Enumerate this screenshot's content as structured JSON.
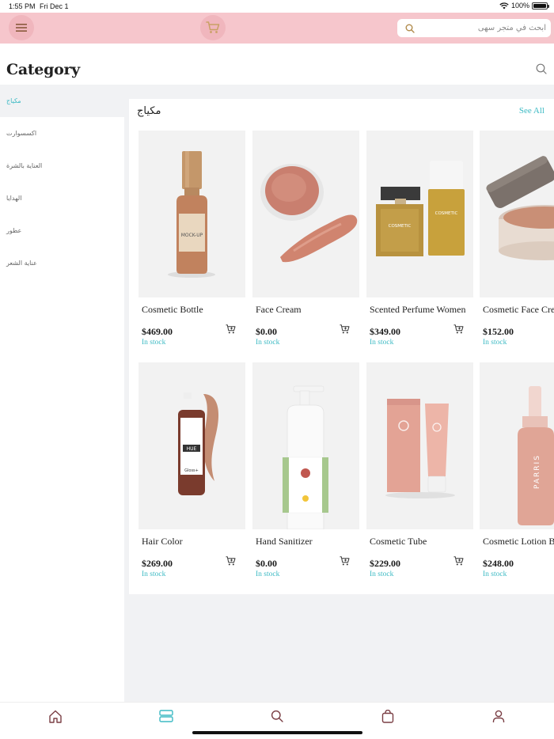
{
  "status_bar": {
    "time": "1:55 PM",
    "date": "Fri Dec 1",
    "battery": "100%"
  },
  "header": {
    "search_placeholder": "ابحث في متجر سهى"
  },
  "page": {
    "title": "Category"
  },
  "sidebar": {
    "items": [
      {
        "label": "مكياج",
        "active": true
      },
      {
        "label": "اكسسوارت",
        "active": false
      },
      {
        "label": "العناية بالشرة",
        "active": false
      },
      {
        "label": "الهدايا",
        "active": false
      },
      {
        "label": "عطور",
        "active": false
      },
      {
        "label": "عناية الشعر",
        "active": false
      }
    ]
  },
  "section": {
    "title": "مكياج",
    "see_all": "See All"
  },
  "products": [
    {
      "name": "Cosmetic Bottle",
      "price": "$469.00",
      "stock": "In stock",
      "icon": "cosmetic-bottle-image"
    },
    {
      "name": "Face Cream",
      "price": "$0.00",
      "stock": "In stock",
      "icon": "face-cream-image"
    },
    {
      "name": "Scented Perfume Women",
      "price": "$349.00",
      "stock": "In stock",
      "icon": "perfume-image"
    },
    {
      "name": "Cosmetic Face Cream",
      "price": "$152.00",
      "stock": "In stock",
      "icon": "face-cream-jar-image"
    },
    {
      "name": "Hair Color",
      "price": "$269.00",
      "stock": "In stock",
      "icon": "hair-color-image"
    },
    {
      "name": "Hand Sanitizer",
      "price": "$0.00",
      "stock": "In stock",
      "icon": "hand-sanitizer-image"
    },
    {
      "name": "Cosmetic Tube",
      "price": "$229.00",
      "stock": "In stock",
      "icon": "cosmetic-tube-image"
    },
    {
      "name": "Cosmetic Lotion Bottle",
      "price": "$248.00",
      "stock": "In stock",
      "icon": "lotion-bottle-image"
    }
  ],
  "product_label_text": {
    "mockup": "MOCK-UP",
    "cosmetic": "COSMETIC",
    "hue": "HUE",
    "gloss": "Gloss+",
    "parris": "PARRIS"
  },
  "tabs": [
    {
      "name": "home",
      "active": false
    },
    {
      "name": "category",
      "active": true
    },
    {
      "name": "search",
      "active": false
    },
    {
      "name": "bag",
      "active": false
    },
    {
      "name": "profile",
      "active": false
    }
  ],
  "colors": {
    "header_pink": "#f6c6cc",
    "accent_teal": "#3dbac4",
    "icon_gold": "#c9a064",
    "icon_maroon": "#7a3e44"
  }
}
